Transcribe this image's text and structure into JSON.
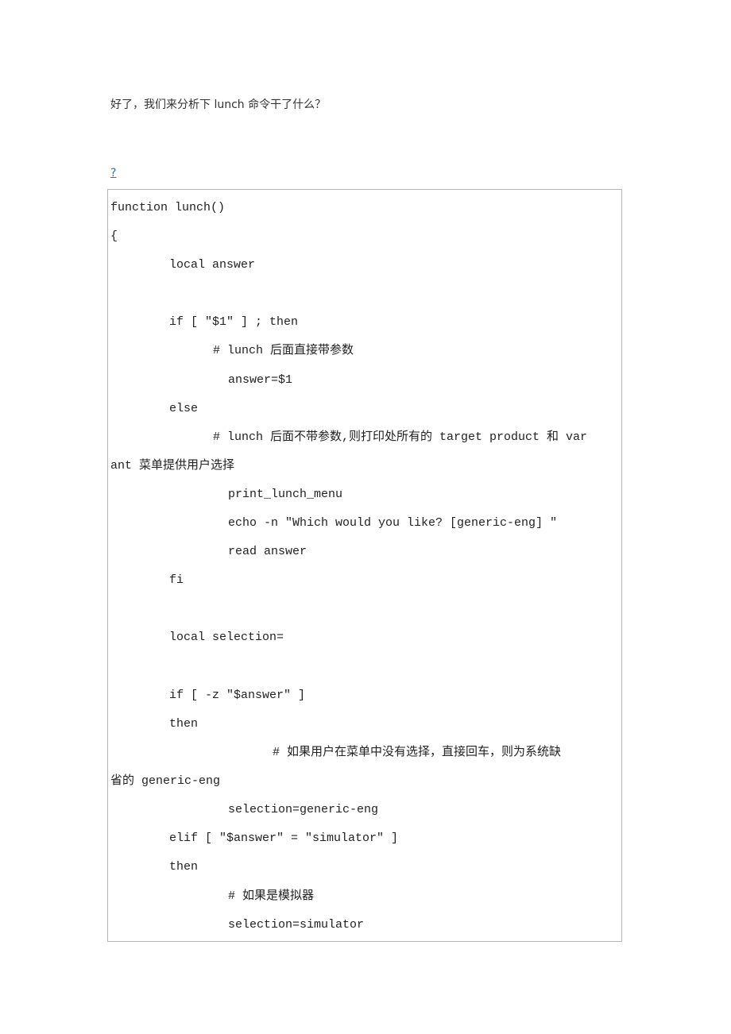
{
  "intro": "好了，我们来分析下 lunch 命令干了什么？",
  "link": "?",
  "code": [
    "function lunch()",
    "{",
    "local answer",
    "if [ \"$1\" ] ; then",
    "# lunch 后面直接带参数",
    "answer=$1",
    "else",
    "# lunch 后面不带参数,则打印处所有的 target product 和 var",
    "ant 菜单提供用户选择",
    "print_lunch_menu",
    "echo -n \"Which would you like? [generic-eng] \"",
    "read answer",
    "fi",
    "local selection=",
    "if [ -z \"$answer\" ]",
    "then",
    "# 如果用户在菜单中没有选择，直接回车，则为系统缺",
    "省的 generic-eng",
    "selection=generic-eng",
    "elif [ \"$answer\" = \"simulator\" ]",
    "then",
    "# 如果是模拟器",
    "selection=simulator"
  ]
}
